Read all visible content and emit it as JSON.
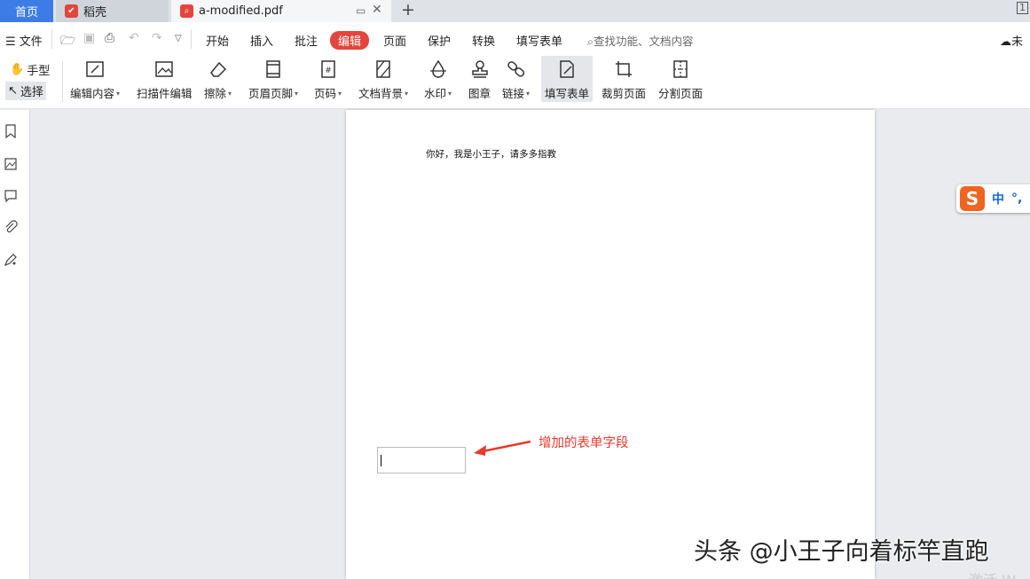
{
  "tabs": {
    "home": "首页",
    "daoke": "稻壳",
    "pdf": "a-modified.pdf",
    "window_number": "1"
  },
  "menu": {
    "file": "文件",
    "items": [
      "开始",
      "插入",
      "批注",
      "编辑",
      "页面",
      "保护",
      "转换",
      "填写表单"
    ],
    "active": "编辑",
    "search_placeholder": "查找功能、文档内容",
    "cloud_status": "未"
  },
  "toolbar": {
    "hand": "手型",
    "select": "选择",
    "tools": [
      {
        "label": "编辑内容",
        "icon": "edit-content-icon",
        "dropdown": true
      },
      {
        "label": "扫描件编辑",
        "icon": "scan-edit-icon",
        "dropdown": false
      },
      {
        "label": "擦除",
        "icon": "eraser-icon",
        "dropdown": true
      },
      {
        "label": "页眉页脚",
        "icon": "header-footer-icon",
        "dropdown": true
      },
      {
        "label": "页码",
        "icon": "page-number-icon",
        "dropdown": true
      },
      {
        "label": "文档背景",
        "icon": "background-icon",
        "dropdown": true
      },
      {
        "label": "水印",
        "icon": "watermark-icon",
        "dropdown": true
      },
      {
        "label": "图章",
        "icon": "stamp-icon",
        "dropdown": false
      },
      {
        "label": "链接",
        "icon": "link-icon",
        "dropdown": true
      },
      {
        "label": "填写表单",
        "icon": "fill-form-icon",
        "dropdown": false,
        "active": true
      },
      {
        "label": "裁剪页面",
        "icon": "crop-icon",
        "dropdown": false
      },
      {
        "label": "分割页面",
        "icon": "split-icon",
        "dropdown": false
      }
    ]
  },
  "document": {
    "text": "你好，我是小王子，请多多指教"
  },
  "annotation": "增加的表单字段",
  "ime": {
    "mode": "中",
    "punct": "°,"
  },
  "watermark": "头条 @小王子向着标竿直跑",
  "activate_hint": "激活 W"
}
